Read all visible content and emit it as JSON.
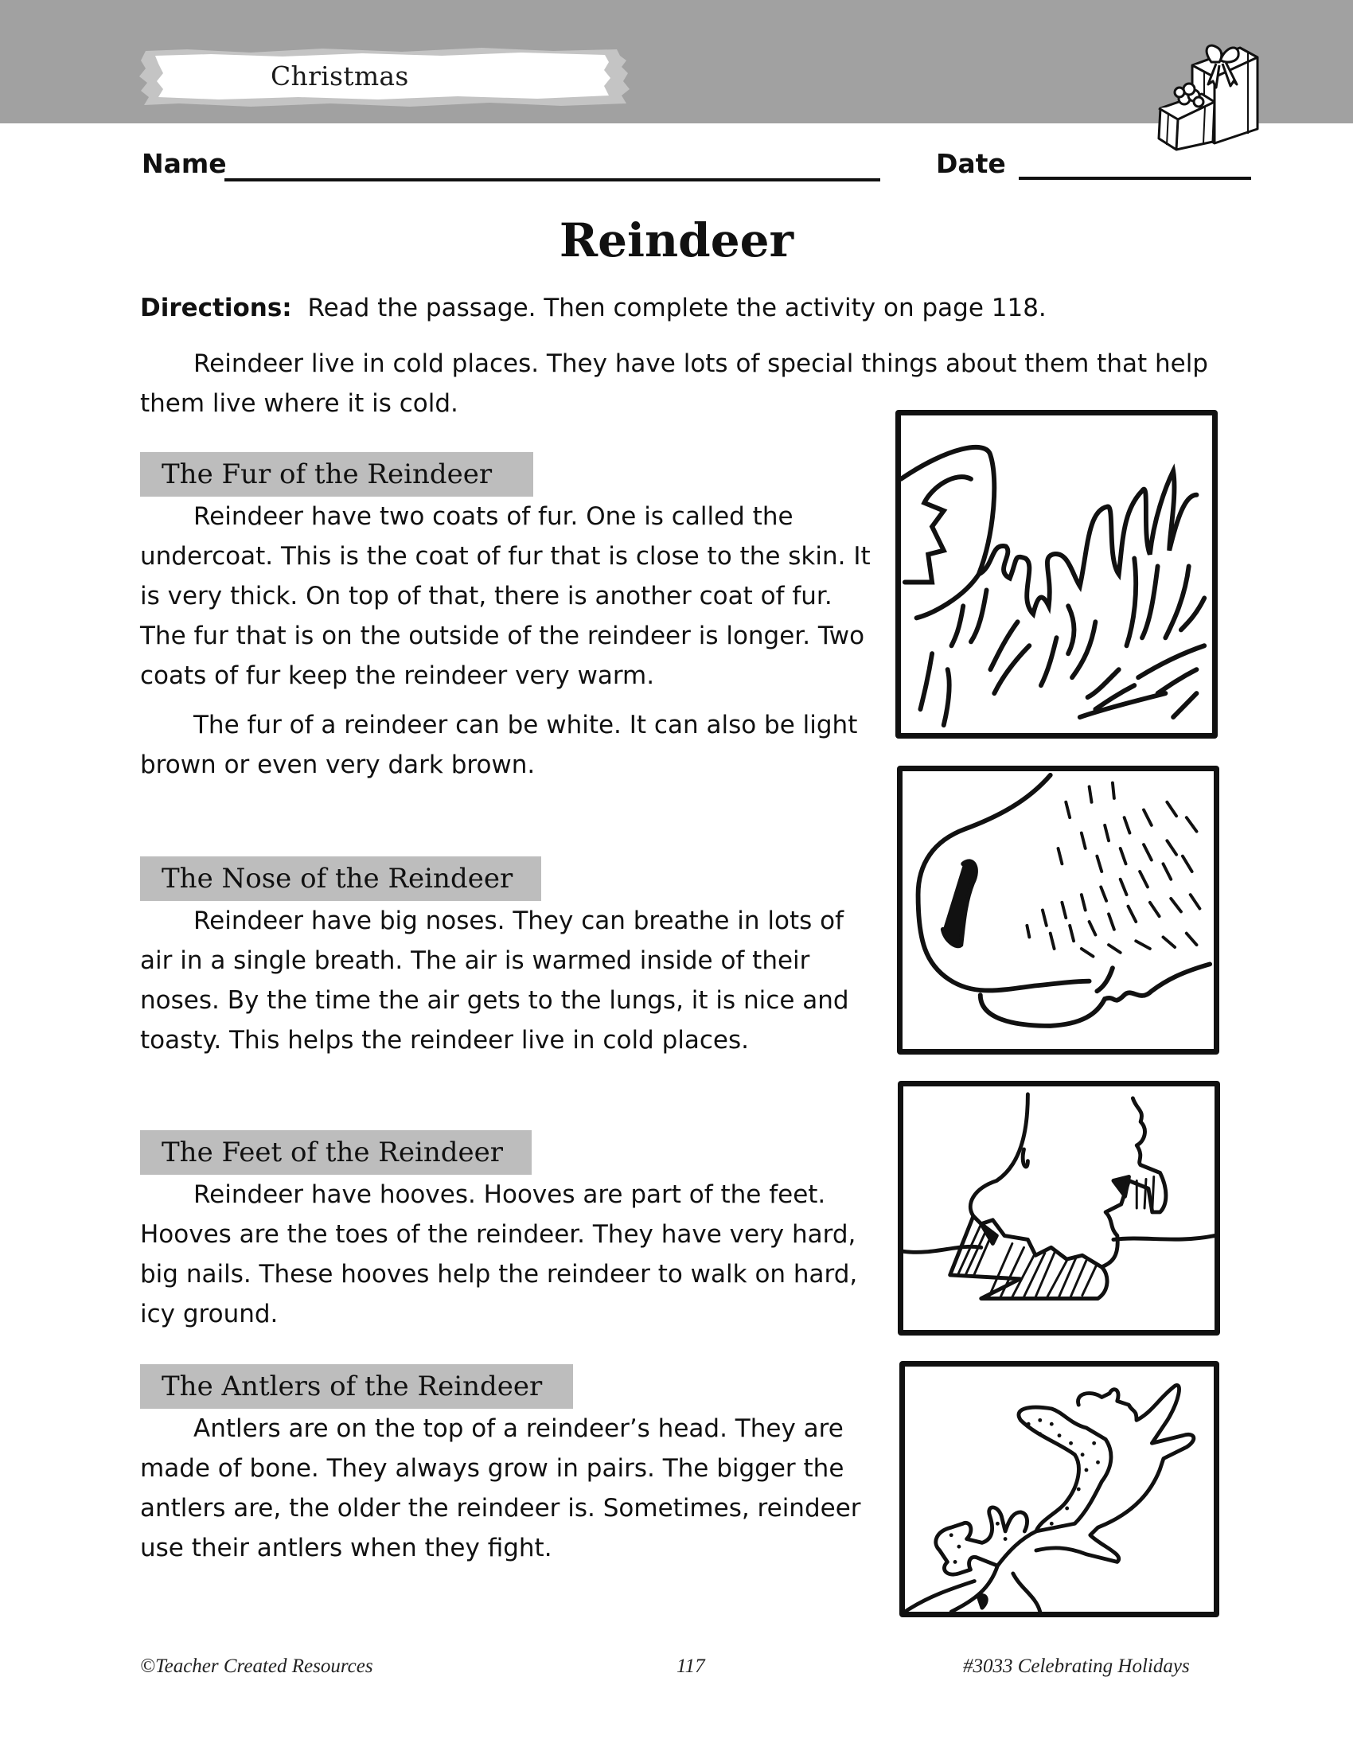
{
  "header": {
    "category_label": "Christmas",
    "decoration_icon": "gift-boxes-icon",
    "band_color": "#a1a1a1"
  },
  "form": {
    "name_label": "Name",
    "name_value": "",
    "date_label": "Date",
    "date_value": ""
  },
  "title": "Reindeer",
  "directions": {
    "label": "Directions:",
    "text": "Read the passage.  Then complete the activity on page 118."
  },
  "intro": "Reindeer live in cold places.  They have lots of special things about them that help them live where it is cold.",
  "sections": [
    {
      "heading": "The Fur of the Reindeer",
      "paragraphs": [
        "Reindeer have two coats of fur.  One is called the undercoat.  This is the coat of fur that is close to the skin.  It is very thick.  On top of that, there is another coat of fur.  The fur that is on the outside of the reindeer is longer.  Two coats of fur keep the reindeer very warm.",
        "The fur of a reindeer can be white.  It can also be light brown or even very dark brown."
      ],
      "illustration": "reindeer-fur-illustration"
    },
    {
      "heading": "The Nose of the Reindeer",
      "paragraphs": [
        "Reindeer have big noses.  They can breathe in lots of air in a single breath.  The air is warmed inside of their noses.  By the time the air gets to the lungs, it is nice and toasty.  This helps the reindeer live in cold places."
      ],
      "illustration": "reindeer-nose-illustration"
    },
    {
      "heading": "The Feet of the Reindeer",
      "paragraphs": [
        "Reindeer have hooves.  Hooves are part of the feet. Hooves are the toes of the reindeer.  They have very hard, big nails.  These hooves help the reindeer to walk on hard, icy ground."
      ],
      "illustration": "reindeer-hooves-illustration"
    },
    {
      "heading": "The Antlers of the Reindeer",
      "paragraphs": [
        "Antlers are on the top of a reindeer’s head. They are made of bone.  They always grow in pairs. The bigger the antlers are, the older the reindeer is. Sometimes, reindeer use their antlers when they fight."
      ],
      "illustration": "reindeer-antlers-illustration"
    }
  ],
  "footer": {
    "copyright": "©Teacher Created Resources",
    "page_number": "117",
    "book": "#3033 Celebrating Holidays"
  }
}
